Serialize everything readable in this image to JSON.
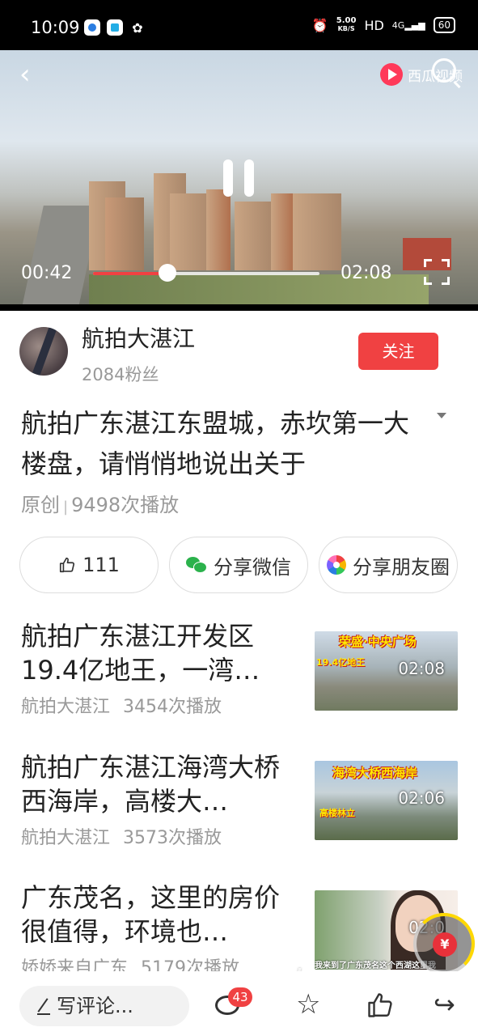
{
  "status_bar": {
    "time": "10:09",
    "network_speed_value": "5.00",
    "network_speed_unit": "KB/S",
    "hd": "HD",
    "signal": "4G",
    "battery": "60",
    "icons": [
      "app-icon-blue",
      "app-icon-bilibili",
      "uc-browser-icon",
      "alarm-icon",
      "signal-icon"
    ]
  },
  "video": {
    "app_logo": "西瓜视频",
    "current_time": "00:42",
    "duration": "02:08",
    "progress_fraction": 0.33,
    "accent_color": "#f04142"
  },
  "author": {
    "name": "航拍大湛江",
    "fans": "2084粉丝",
    "follow_label": "关注"
  },
  "main": {
    "title": "航拍广东湛江东盟城，赤坎第一大楼盘，请悄悄地说出关于",
    "meta_original": "原创",
    "meta_sep": "|",
    "meta_plays": "9498次播放"
  },
  "actions": {
    "like_count": "111",
    "share_wechat": "分享微信",
    "share_moments": "分享朋友圈"
  },
  "related": [
    {
      "title": "航拍广东湛江开发区19.4亿地王，一湾…",
      "author": "航拍大湛江",
      "plays": "3454次播放",
      "duration": "02:08",
      "overlay": "荣盛·中央广场",
      "overlay_sub": "19.4亿地王"
    },
    {
      "title": "航拍广东湛江海湾大桥西海岸，高楼大…",
      "author": "航拍大湛江",
      "plays": "3573次播放",
      "duration": "02:06",
      "overlay": "海湾大桥西海岸",
      "overlay_sub": "高楼林立"
    },
    {
      "title": "广东茂名，这里的房价很值得，环境也…",
      "author": "娇娇来自广东",
      "plays": "5179次播放",
      "duration": "02:0",
      "overlay": "",
      "overlay_sub": "我来到了广东茂名这个西湖这里我"
    }
  ],
  "bottom": {
    "comment_placeholder": "写评论...",
    "comment_count": "43"
  },
  "red_packet_symbol": "¥",
  "watermark": "gdmm.com"
}
